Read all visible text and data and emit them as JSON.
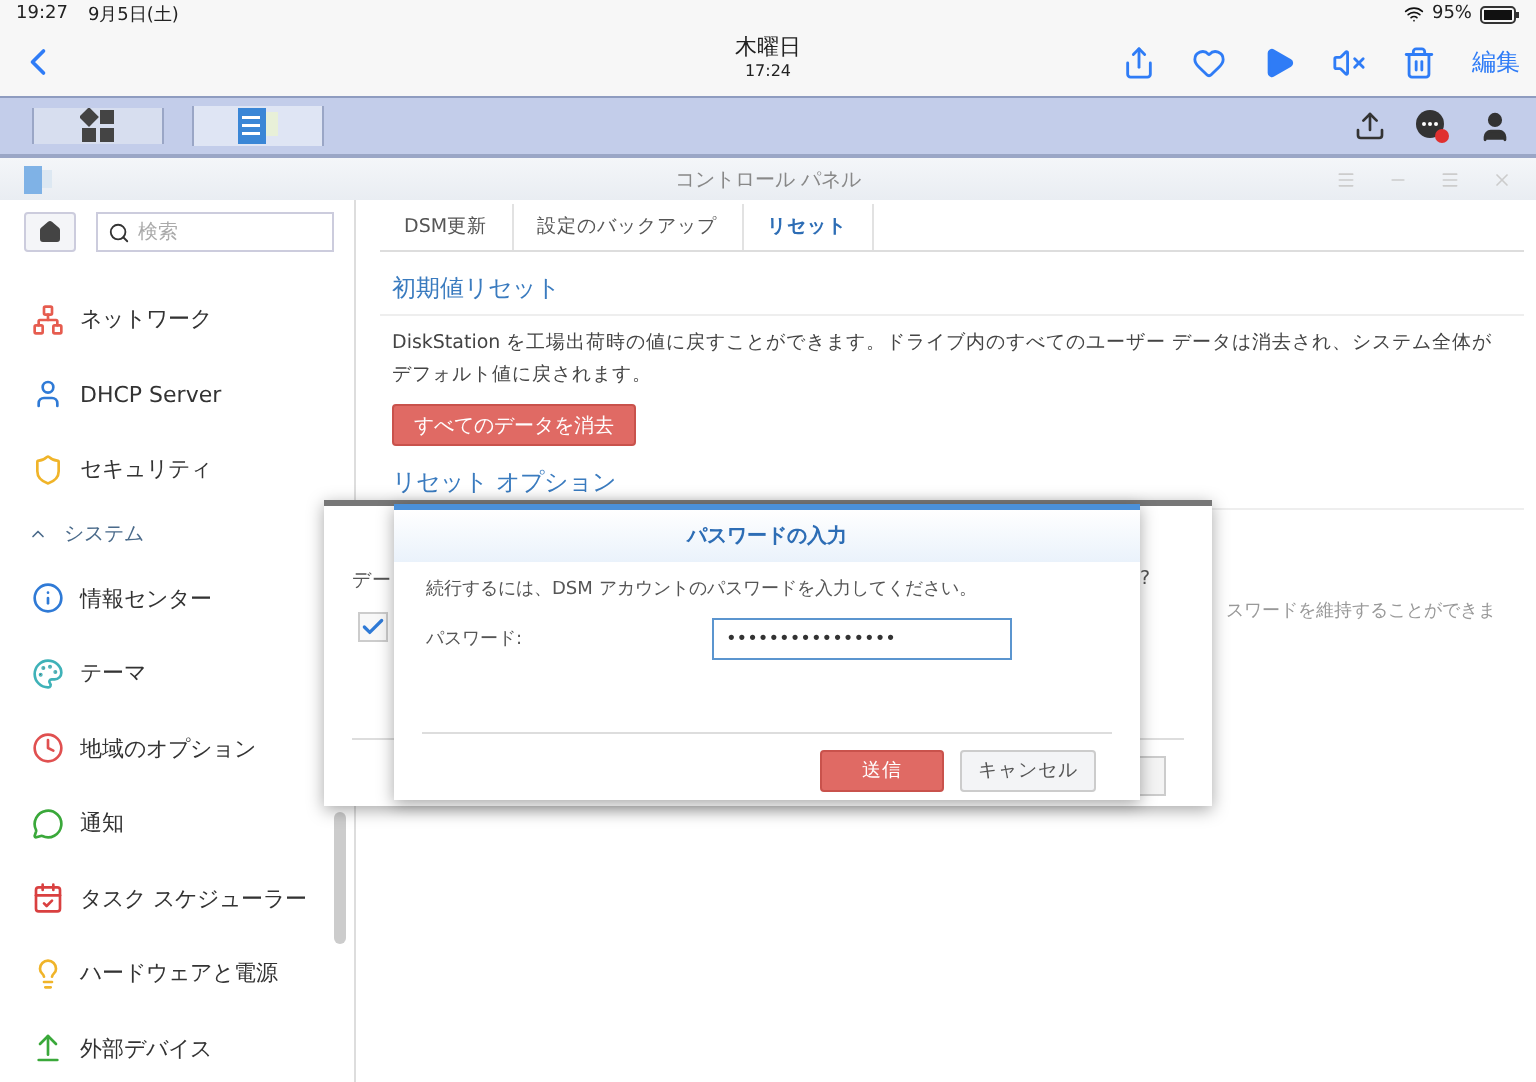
{
  "status_bar": {
    "time": "19:27",
    "date": "9月5日(土)",
    "battery": "95%"
  },
  "nav_bar": {
    "title": "木曜日",
    "subtitle": "17:24",
    "edit": "編集"
  },
  "window": {
    "title": "コントロール パネル"
  },
  "sidebar": {
    "search": {
      "placeholder": "検索"
    },
    "items": [
      {
        "kind": "item",
        "label": "ネットワーク"
      },
      {
        "kind": "item",
        "label": "DHCP Server"
      },
      {
        "kind": "item",
        "label": "セキュリティ"
      },
      {
        "kind": "section",
        "label": "システム",
        "expanded": true
      },
      {
        "kind": "item",
        "label": "情報センター"
      },
      {
        "kind": "item",
        "label": "テーマ"
      },
      {
        "kind": "item",
        "label": "地域のオプション"
      },
      {
        "kind": "item",
        "label": "通知"
      },
      {
        "kind": "item",
        "label": "タスク スケジューラー"
      },
      {
        "kind": "item",
        "label": "ハードウェアと電源"
      },
      {
        "kind": "item",
        "label": "外部デバイス"
      }
    ]
  },
  "content": {
    "tabs": [
      {
        "label": "DSM更新",
        "selected": false
      },
      {
        "label": "設定のバックアップ",
        "selected": false
      },
      {
        "label": "リセット",
        "selected": true
      }
    ],
    "heading": "初期値リセット",
    "paragraph": "DiskStation を工場出荷時の値に戻すことができます。ドライブ内のすべてのユーザー データは消去され、システム全体がデフォルト値に戻されます。",
    "erase_button": "すべてのデータを消去",
    "options_heading": "リセット オプション",
    "options_text": "スワードを維持することができま"
  },
  "back_dialog": {
    "text_left": "デー",
    "text_right": "?",
    "checked": true
  },
  "dialog": {
    "title": "パスワードの入力",
    "message": "続行するには、DSM アカウントのパスワードを入力してください。",
    "password_label": "パスワード:",
    "password_value": "••••••••••••••••",
    "buttons": [
      {
        "label": "送信",
        "kind": "primary"
      },
      {
        "label": "キャンセル",
        "kind": "secondary"
      }
    ]
  }
}
